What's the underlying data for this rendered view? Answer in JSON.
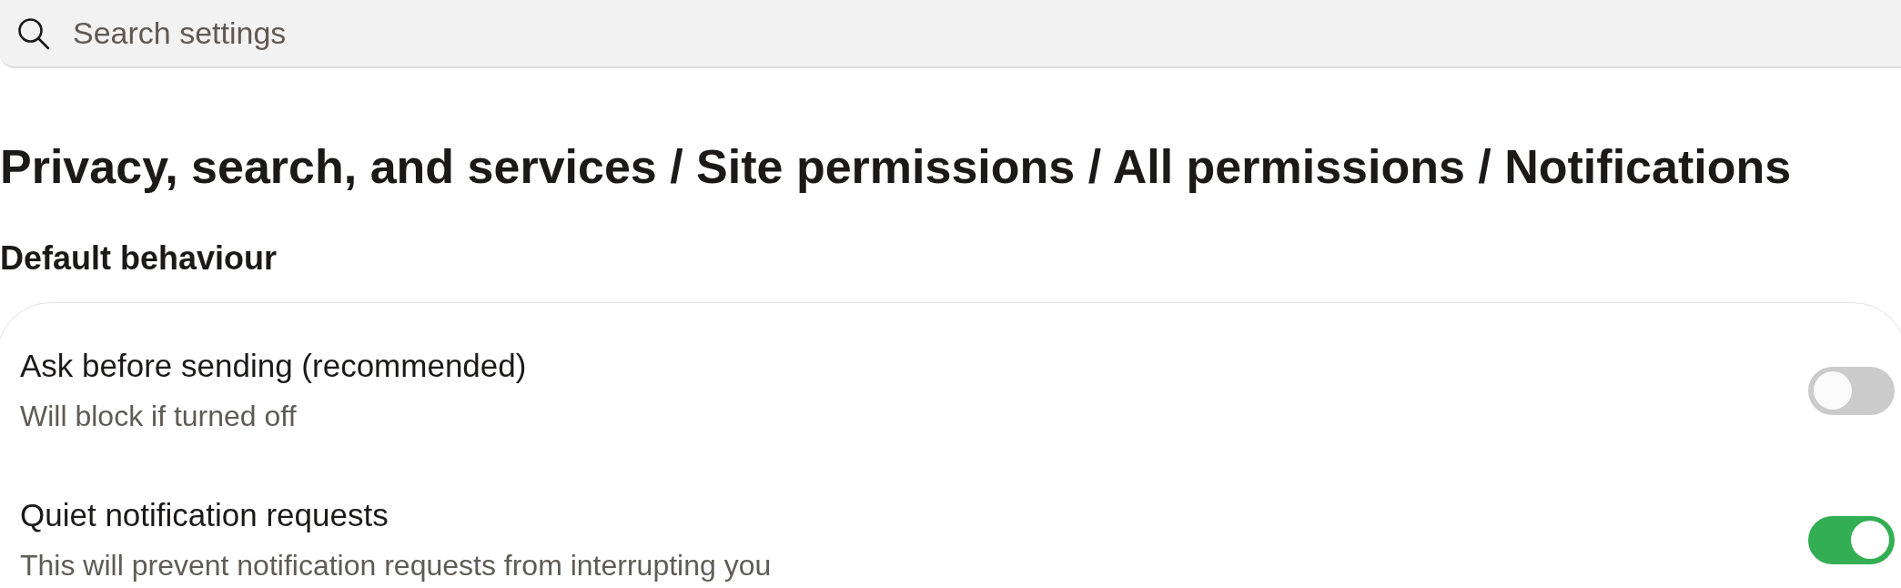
{
  "search": {
    "placeholder": "Search settings"
  },
  "heading": "Privacy, search, and services / Site permissions / All permissions / Notifications",
  "section": {
    "title": "Default behaviour",
    "settings": [
      {
        "title": "Ask before sending (recommended)",
        "description": "Will block if turned off",
        "on": false
      },
      {
        "title": "Quiet notification requests",
        "description": "This will prevent notification requests from interrupting you",
        "on": true
      }
    ]
  }
}
